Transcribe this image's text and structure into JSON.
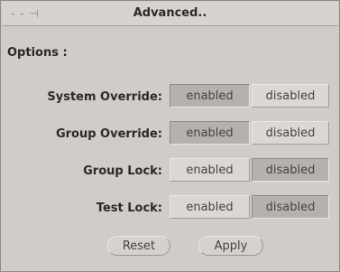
{
  "window": {
    "title": "Advanced..",
    "title_icons": "- - ⊣"
  },
  "options_label": "Options :",
  "rows": [
    {
      "label": "System Override:",
      "enabled_label": "enabled",
      "disabled_label": "disabled",
      "selected": "enabled"
    },
    {
      "label": "Group Override:",
      "enabled_label": "enabled",
      "disabled_label": "disabled",
      "selected": "enabled"
    },
    {
      "label": "Group Lock:",
      "enabled_label": "enabled",
      "disabled_label": "disabled",
      "selected": "disabled"
    },
    {
      "label": "Test Lock:",
      "enabled_label": "enabled",
      "disabled_label": "disabled",
      "selected": "disabled"
    }
  ],
  "buttons": {
    "reset_label": "Reset",
    "apply_label": "Apply"
  }
}
